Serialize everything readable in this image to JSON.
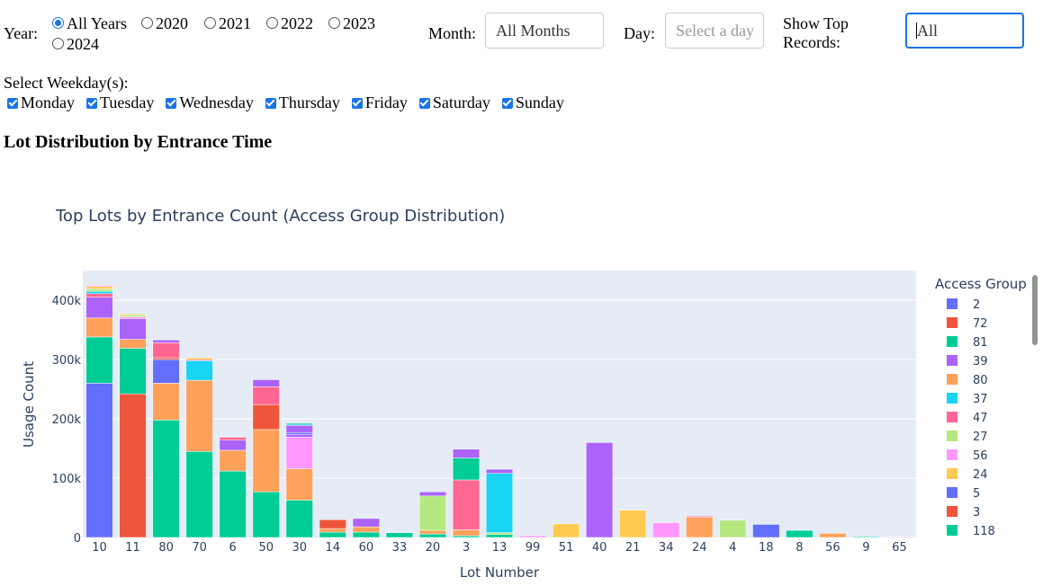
{
  "filters": {
    "year_label": "Year:",
    "year_options": [
      "All Years",
      "2020",
      "2021",
      "2022",
      "2023",
      "2024"
    ],
    "year_selected": "All Years",
    "month_label": "Month:",
    "month_value": "All Months",
    "day_label": "Day:",
    "day_placeholder": "Select a day",
    "top_label_line1": "Show Top",
    "top_label_line2": "Records:",
    "top_value": "All",
    "weekday_label": "Select Weekday(s):",
    "weekdays": [
      "Monday",
      "Tuesday",
      "Wednesday",
      "Thursday",
      "Friday",
      "Saturday",
      "Sunday"
    ]
  },
  "section_title": "Lot Distribution by Entrance Time",
  "colors": {
    "plot_bg": "#e5ecf6",
    "accent": "#1a73e8",
    "2": "#636efa",
    "72": "#ef553b",
    "81": "#00cc96",
    "39": "#ab63fa",
    "80": "#ffa15a",
    "37": "#19d3f3",
    "47": "#ff6692",
    "27": "#b6e880",
    "56": "#ff97ff",
    "24": "#fecb52",
    "5": "#636efa",
    "3": "#ef553b",
    "118": "#00cc96"
  },
  "chart_data": {
    "type": "bar",
    "stacked": true,
    "title": "Top Lots by Entrance Count (Access Group Distribution)",
    "xlabel": "Lot Number",
    "ylabel": "Usage Count",
    "ylim": [
      0,
      450000
    ],
    "yticks": [
      0,
      100000,
      200000,
      300000,
      400000
    ],
    "ytick_labels": [
      "0",
      "100k",
      "200k",
      "300k",
      "400k"
    ],
    "grid": true,
    "legend_title": "Access Group",
    "legend_placement": "right",
    "legend_items": [
      "2",
      "72",
      "81",
      "39",
      "80",
      "37",
      "47",
      "27",
      "56",
      "24",
      "5",
      "3",
      "118"
    ],
    "categories": [
      "10",
      "11",
      "80",
      "70",
      "6",
      "50",
      "30",
      "14",
      "60",
      "33",
      "20",
      "3",
      "13",
      "99",
      "51",
      "40",
      "21",
      "34",
      "24",
      "4",
      "18",
      "8",
      "56",
      "9",
      "65"
    ],
    "stacks": [
      [
        {
          "g": "2",
          "v": 260000
        },
        {
          "g": "81",
          "v": 78000
        },
        {
          "g": "80",
          "v": 32000
        },
        {
          "g": "39",
          "v": 35000
        },
        {
          "g": "47",
          "v": 6000
        },
        {
          "g": "37",
          "v": 4000
        },
        {
          "g": "27",
          "v": 4000
        },
        {
          "g": "24",
          "v": 4000
        },
        {
          "g": "56",
          "v": 2000
        }
      ],
      [
        {
          "g": "72",
          "v": 242000
        },
        {
          "g": "81",
          "v": 77000
        },
        {
          "g": "80",
          "v": 15000
        },
        {
          "g": "39",
          "v": 35000
        },
        {
          "g": "56",
          "v": 3000
        },
        {
          "g": "27",
          "v": 3000
        },
        {
          "g": "24",
          "v": 2000
        }
      ],
      [
        {
          "g": "81",
          "v": 198000
        },
        {
          "g": "80",
          "v": 62000
        },
        {
          "g": "2",
          "v": 40000
        },
        {
          "g": "72",
          "v": 3000
        },
        {
          "g": "47",
          "v": 25000
        },
        {
          "g": "39",
          "v": 5000
        }
      ],
      [
        {
          "g": "81",
          "v": 145000
        },
        {
          "g": "80",
          "v": 120000
        },
        {
          "g": "37",
          "v": 33000
        },
        {
          "g": "47",
          "v": 2000
        },
        {
          "g": "24",
          "v": 3000
        }
      ],
      [
        {
          "g": "81",
          "v": 112000
        },
        {
          "g": "80",
          "v": 35000
        },
        {
          "g": "39",
          "v": 17000
        },
        {
          "g": "47",
          "v": 5000
        }
      ],
      [
        {
          "g": "81",
          "v": 77000
        },
        {
          "g": "80",
          "v": 105000
        },
        {
          "g": "72",
          "v": 42000
        },
        {
          "g": "47",
          "v": 30000
        },
        {
          "g": "39",
          "v": 12000
        }
      ],
      [
        {
          "g": "81",
          "v": 63000
        },
        {
          "g": "80",
          "v": 53000
        },
        {
          "g": "56",
          "v": 53000
        },
        {
          "g": "39",
          "v": 5000
        },
        {
          "g": "2",
          "v": 3000
        },
        {
          "g": "39",
          "v": 12000
        },
        {
          "g": "37",
          "v": 2000
        },
        {
          "g": "81",
          "v": 2000
        }
      ],
      [
        {
          "g": "81",
          "v": 9000
        },
        {
          "g": "80",
          "v": 6000
        },
        {
          "g": "72",
          "v": 15000
        }
      ],
      [
        {
          "g": "81",
          "v": 9000
        },
        {
          "g": "80",
          "v": 9000
        },
        {
          "g": "39",
          "v": 14000
        }
      ],
      [
        {
          "g": "81",
          "v": 8000
        }
      ],
      [
        {
          "g": "81",
          "v": 6000
        },
        {
          "g": "80",
          "v": 6000
        },
        {
          "g": "27",
          "v": 58000
        },
        {
          "g": "39",
          "v": 7000
        }
      ],
      [
        {
          "g": "81",
          "v": 3000
        },
        {
          "g": "80",
          "v": 10000
        },
        {
          "g": "47",
          "v": 84000
        },
        {
          "g": "81",
          "v": 37000
        },
        {
          "g": "39",
          "v": 15000
        }
      ],
      [
        {
          "g": "81",
          "v": 5000
        },
        {
          "g": "27",
          "v": 3000
        },
        {
          "g": "37",
          "v": 100000
        },
        {
          "g": "39",
          "v": 7000
        }
      ],
      [
        {
          "g": "56",
          "v": 3000
        }
      ],
      [
        {
          "g": "24",
          "v": 23000
        }
      ],
      [
        {
          "g": "39",
          "v": 160000
        }
      ],
      [
        {
          "g": "24",
          "v": 46000
        }
      ],
      [
        {
          "g": "56",
          "v": 25000
        }
      ],
      [
        {
          "g": "80",
          "v": 34000
        },
        {
          "g": "47",
          "v": 2000
        }
      ],
      [
        {
          "g": "27",
          "v": 29000
        }
      ],
      [
        {
          "g": "5",
          "v": 22000
        }
      ],
      [
        {
          "g": "118",
          "v": 12000
        }
      ],
      [
        {
          "g": "80",
          "v": 7000
        }
      ],
      [
        {
          "g": "118",
          "v": 1500
        }
      ],
      [
        {
          "g": "56",
          "v": 500
        }
      ]
    ]
  }
}
